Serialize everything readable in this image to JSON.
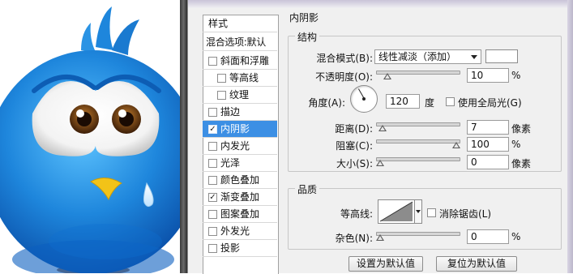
{
  "style_list": {
    "header": "样式",
    "blend_defaults": "混合选项:默认",
    "items": [
      {
        "label": "斜面和浮雕",
        "checked": false,
        "indent": false,
        "selected": false
      },
      {
        "label": "等高线",
        "checked": false,
        "indent": true,
        "selected": false
      },
      {
        "label": "纹理",
        "checked": false,
        "indent": true,
        "selected": false
      },
      {
        "label": "描边",
        "checked": false,
        "indent": false,
        "selected": false
      },
      {
        "label": "内阴影",
        "checked": true,
        "indent": false,
        "selected": true
      },
      {
        "label": "内发光",
        "checked": false,
        "indent": false,
        "selected": false
      },
      {
        "label": "光泽",
        "checked": false,
        "indent": false,
        "selected": false
      },
      {
        "label": "颜色叠加",
        "checked": false,
        "indent": false,
        "selected": false
      },
      {
        "label": "渐变叠加",
        "checked": true,
        "indent": false,
        "selected": false
      },
      {
        "label": "图案叠加",
        "checked": false,
        "indent": false,
        "selected": false
      },
      {
        "label": "外发光",
        "checked": false,
        "indent": false,
        "selected": false
      },
      {
        "label": "投影",
        "checked": false,
        "indent": false,
        "selected": false
      }
    ]
  },
  "panel": {
    "title": "内阴影",
    "structure": {
      "legend": "结构",
      "blend_mode_label": "混合模式(B):",
      "blend_mode_value": "线性减淡（添加）",
      "shadow_color": "#ffffff",
      "opacity_label": "不透明度(O):",
      "opacity_value": "10",
      "opacity_unit": "%",
      "opacity_level": 10,
      "angle_label": "角度(A):",
      "angle_value": "120",
      "angle_unit": "度",
      "global_light_label": "使用全局光(G)",
      "global_light_checked": false,
      "distance_label": "距离(D):",
      "distance_value": "7",
      "distance_unit": "像素",
      "distance_level": 7,
      "choke_label": "阻塞(C):",
      "choke_value": "100",
      "choke_unit": "%",
      "choke_level": 100,
      "size_label": "大小(S):",
      "size_value": "0",
      "size_unit": "像素",
      "size_level": 0
    },
    "quality": {
      "legend": "品质",
      "contour_label": "等高线:",
      "antialias_label": "消除锯齿(L)",
      "antialias_checked": false,
      "noise_label": "杂色(N):",
      "noise_value": "0",
      "noise_unit": "%",
      "noise_level": 0
    },
    "buttons": {
      "make_default": "设置为默认值",
      "reset_default": "复位为默认值"
    }
  },
  "colors": {
    "selection": "#3c8fe4",
    "bird_blue": "#1e86dc",
    "beak": "#f2c318"
  }
}
